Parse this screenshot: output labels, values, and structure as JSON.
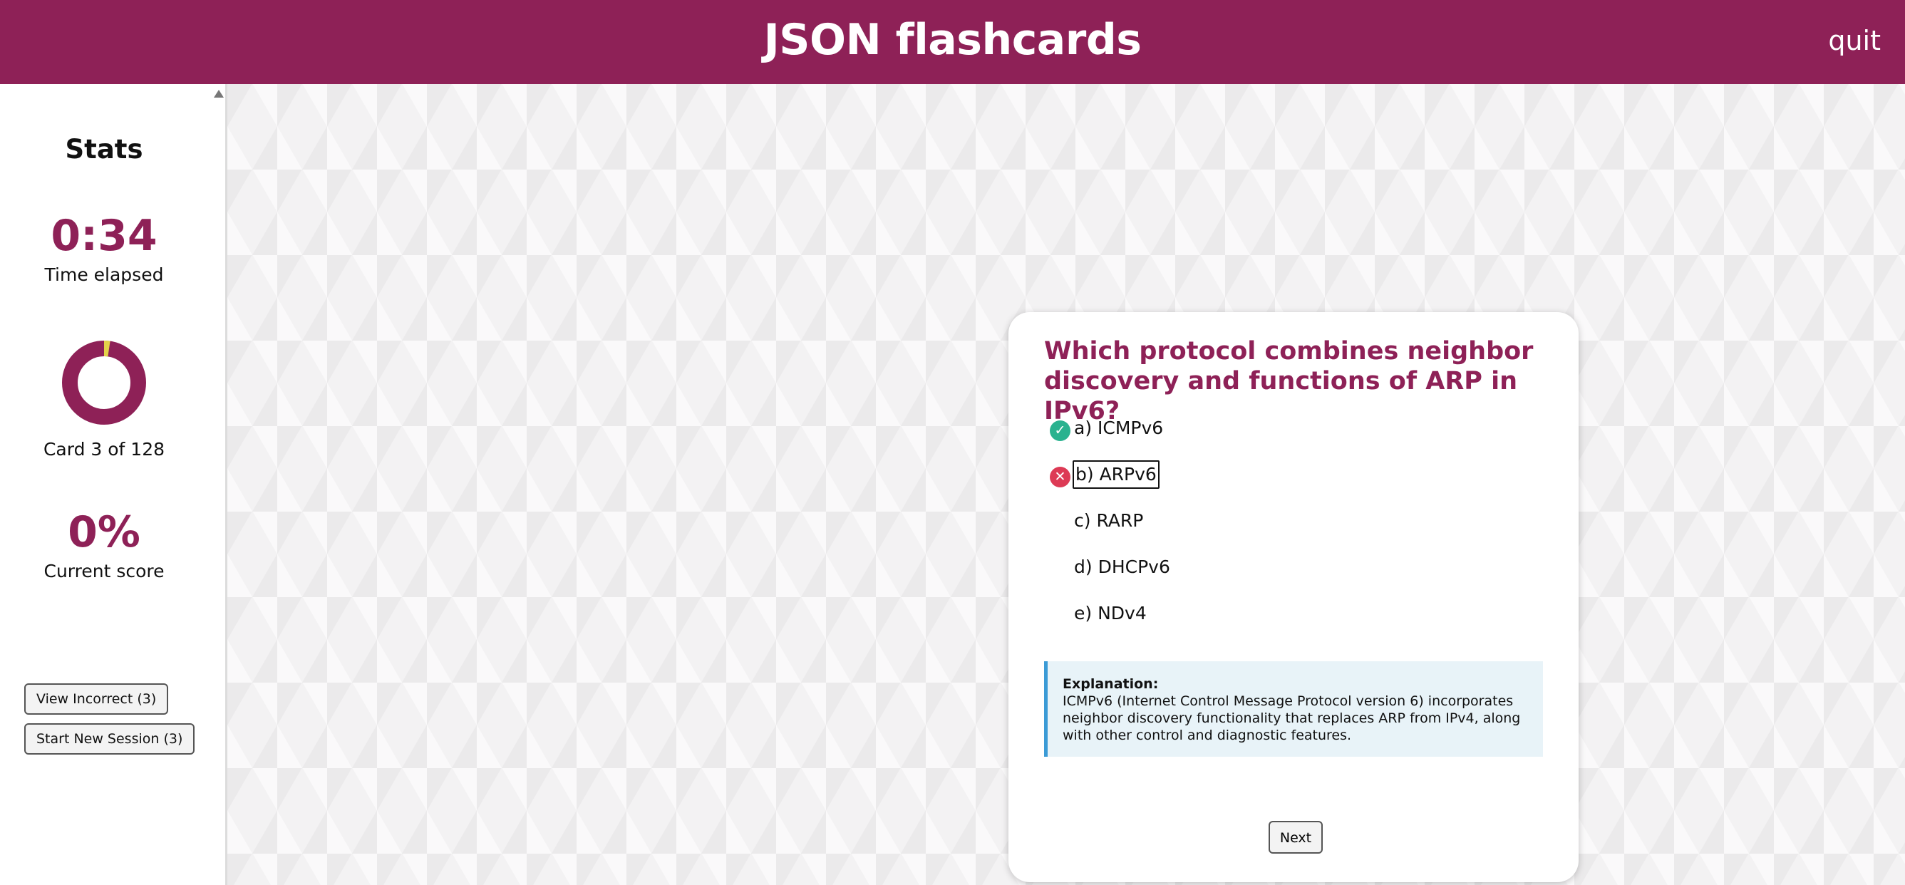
{
  "header": {
    "title": "JSON flashcards",
    "quit_label": "quit"
  },
  "sidebar": {
    "stats_title": "Stats",
    "time_value": "0:34",
    "time_label": "Time elapsed",
    "progress_fraction": 0.0234,
    "card_label": "Card 3 of 128",
    "score_value": "0%",
    "score_label": "Current score",
    "view_incorrect_label": "View Incorrect (3)",
    "new_session_label": "Start New Session (3)"
  },
  "card": {
    "question": "Which protocol combines neighbor discovery and functions of ARP in IPv6?",
    "options": [
      {
        "label": "a) ICMPv6",
        "status": "correct"
      },
      {
        "label": "b) ARPv6",
        "status": "wrong"
      },
      {
        "label": "c) RARP",
        "status": "none"
      },
      {
        "label": "d) DHCPv6",
        "status": "none"
      },
      {
        "label": "e) NDv4",
        "status": "none"
      }
    ],
    "explanation_title": "Explanation:",
    "explanation_text": "ICMPv6 (Internet Control Message Protocol version 6) incorporates neighbor discovery functionality that replaces ARP from IPv4, along with other control and diagnostic features.",
    "next_label": "Next"
  },
  "colors": {
    "brand": "#8e2157",
    "correct": "#2ab28f",
    "wrong": "#dd3a55",
    "progress_fill": "#e3d24a",
    "explanation_accent": "#3b9bd6"
  },
  "icons": {
    "correct_icon": "check-circle-icon",
    "wrong_icon": "x-circle-icon"
  }
}
